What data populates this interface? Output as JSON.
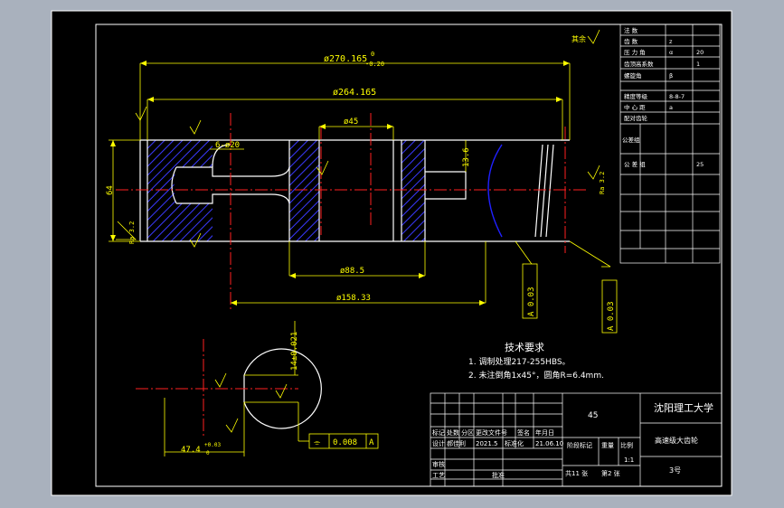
{
  "drawing": {
    "dimensions": {
      "overall_length": "ø270.165",
      "overall_tol_upper": "0",
      "overall_tol_lower": "-0.20",
      "inner_length": "ø264.165",
      "bore_45": "ø45",
      "holes": "6-ø20",
      "height_64": "64",
      "dim_13_6": "13.6",
      "bore_88_5": "ø88.5",
      "bore_158_33": "ø158.33",
      "keyway_depth": "14±0.021",
      "keyway_width": "47.4",
      "keyway_tol_upper": "+0.03",
      "keyway_tol_lower": "0",
      "roughness_sym": "Ra",
      "roughness_value": "3.2"
    },
    "feature_frames": [
      {
        "symbol": "⌯",
        "value": "0.008",
        "datum": "A"
      }
    ],
    "datum_labels": [
      "A 0.03",
      "A 0.03"
    ],
    "other_rough": "其余",
    "tech_requirements": {
      "title": "技术要求",
      "items": [
        "1. 调制处理217-255HBS。",
        "2. 未注倒角1x45°，圆角R=6.4mm."
      ]
    }
  },
  "title_block": {
    "university": "沈阳理工大学",
    "part_name": "高速级大齿轮",
    "material": "45",
    "scale": "1:1",
    "drawing_no": "3号",
    "sheets_total": "共11 张",
    "sheet_no": "第2 张",
    "rev_headers": [
      "标记",
      "处数",
      "分区",
      "更改文件号",
      "签名",
      "年月日"
    ],
    "design_row": [
      "设计",
      "郝佳利",
      "2021.5",
      "标准化",
      "",
      "21.06.10"
    ],
    "review_label": "审核",
    "process_label": "工艺",
    "approve_label": "批准",
    "stage_label": "阶段标记",
    "weight_label": "重量",
    "scale_label": "比例"
  },
  "gear_table": [
    {
      "k": "法 数",
      "c": "",
      "v": ""
    },
    {
      "k": "齿 数",
      "c": "z",
      "v": ""
    },
    {
      "k": "压 力 角",
      "c": "α",
      "v": "20"
    },
    {
      "k": "齿顶高系数",
      "c": "",
      "v": "1"
    },
    {
      "k": "螺旋角",
      "c": "β",
      "v": ""
    },
    {
      "k": "精度等级",
      "c": "",
      "v": "8-8-7"
    },
    {
      "k": "齿 配 对",
      "c": "",
      "v": ""
    },
    {
      "k": "中 心 距",
      "c": "a",
      "v": ""
    },
    {
      "k": "配对齿轮",
      "c": "",
      "v": ""
    },
    {
      "k": "公差组",
      "c": "",
      "v": ""
    },
    {
      "k": "公 差 组",
      "c": "",
      "v": "25"
    }
  ]
}
